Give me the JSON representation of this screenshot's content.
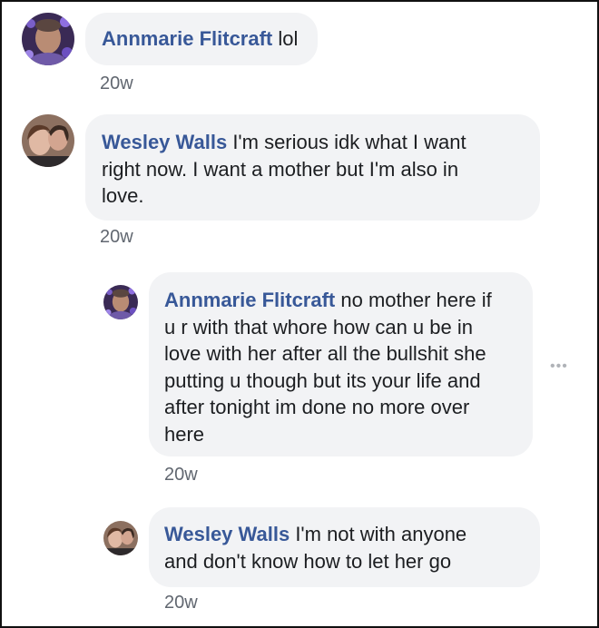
{
  "comments": [
    {
      "author": "Annmarie Flitcraft",
      "text": "lol",
      "time": "20w",
      "avatar": "annmarie-avatar"
    },
    {
      "author": "Wesley Walls",
      "text_lines": [
        "I'm serious idk what I want",
        "right now. I want a mother but I'm also in",
        "love."
      ],
      "time": "20w",
      "avatar": "wesley-avatar"
    }
  ],
  "replies": [
    {
      "author": "Annmarie Flitcraft",
      "text_lines": [
        "no mother here if",
        "u r with that whore how can u be in",
        "love with her after all the bullshit she",
        "putting u though but its your life and",
        "after tonight im done no more over",
        "here"
      ],
      "time": "20w",
      "avatar": "annmarie-avatar",
      "more_icon": "•••"
    },
    {
      "author": "Wesley Walls",
      "text_lines": [
        "I'm not with anyone",
        "and don't know how to let her go"
      ],
      "time": "20w",
      "avatar": "wesley-avatar"
    }
  ],
  "colors": {
    "author": "#385898",
    "bubble": "#f2f3f5",
    "timestamp": "#616770"
  }
}
